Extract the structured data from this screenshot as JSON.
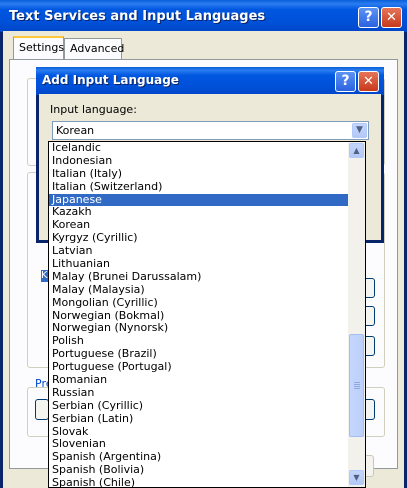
{
  "outer_window": {
    "title": "Text Services and Input Languages",
    "tabs": [
      {
        "label": "Settings",
        "active": true
      },
      {
        "label": "Advanced",
        "active": false
      }
    ],
    "preferences_link_partial": "Pre",
    "apply_label_partial": "ply",
    "hidden_item_letter": "K"
  },
  "dialog": {
    "title": "Add Input Language",
    "input_language_label": "Input language:",
    "selected_value": "Korean"
  },
  "dropdown": {
    "items": [
      "Icelandic",
      "Indonesian",
      "Italian (Italy)",
      "Italian (Switzerland)",
      "Japanese",
      "Kazakh",
      "Korean",
      "Kyrgyz (Cyrillic)",
      "Latvian",
      "Lithuanian",
      "Malay (Brunei Darussalam)",
      "Malay (Malaysia)",
      "Mongolian (Cyrillic)",
      "Norwegian (Bokmal)",
      "Norwegian (Nynorsk)",
      "Polish",
      "Portuguese (Brazil)",
      "Portuguese (Portugal)",
      "Romanian",
      "Russian",
      "Serbian (Cyrillic)",
      "Serbian (Latin)",
      "Slovak",
      "Slovenian",
      "Spanish (Argentina)",
      "Spanish (Bolivia)",
      "Spanish (Chile)"
    ],
    "highlighted": "Japanese"
  },
  "icons": {
    "help": "?",
    "close": "✕",
    "down": "▼",
    "up": "▲"
  },
  "colors": {
    "titlebar": "#0055e5",
    "selection": "#316ac5",
    "tab_highlight": "#ffc83c"
  }
}
